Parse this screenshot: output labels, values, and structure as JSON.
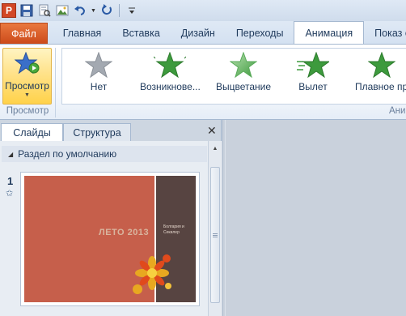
{
  "app": {
    "app_icon_letter": "P"
  },
  "qat": {
    "icons": [
      "powerpoint-app-icon",
      "save-icon",
      "print-preview-icon",
      "picture-icon",
      "undo-icon",
      "redo-icon",
      "customize-icon"
    ]
  },
  "tabs": [
    {
      "label": "Файл",
      "active": false
    },
    {
      "label": "Главная",
      "active": false
    },
    {
      "label": "Вставка",
      "active": false
    },
    {
      "label": "Дизайн",
      "active": false
    },
    {
      "label": "Переходы",
      "active": false
    },
    {
      "label": "Анимация",
      "active": true
    },
    {
      "label": "Показ сл"
    }
  ],
  "ribbon": {
    "preview_label": "Просмотр",
    "preview_group_label": "Просмотр",
    "animation_group_label": "Ани",
    "effects": [
      {
        "label": "Нет",
        "icon": "star-gray-icon"
      },
      {
        "label": "Возникнове...",
        "icon": "star-green-appear-icon"
      },
      {
        "label": "Выцветание",
        "icon": "star-green-fade-icon"
      },
      {
        "label": "Вылет",
        "icon": "star-green-fly-icon"
      },
      {
        "label": "Плавное пр",
        "icon": "star-green-float-icon"
      }
    ]
  },
  "panel": {
    "tab_slides": "Слайды",
    "tab_outline": "Структура",
    "section_label": "Раздел по умолчанию",
    "slide_number": "1",
    "slide": {
      "title": "ЛЕТО 2013",
      "subtitle": "Болгария и Секилер"
    }
  },
  "colors": {
    "file_tab": "#d9592a",
    "slide_left": "#c65f4b",
    "slide_right": "#574441",
    "star_green": "#3d9a3d",
    "star_gray": "#9aa0a8",
    "preview_highlight": "#ffd24a"
  }
}
